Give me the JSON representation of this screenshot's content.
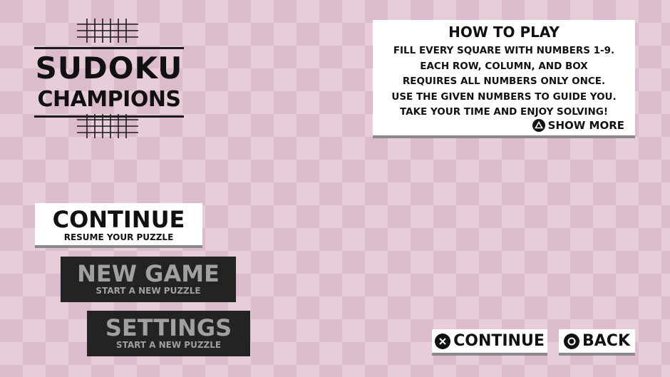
{
  "logo": {
    "line1": "SUDOKU",
    "line2": "CHAMPIONS"
  },
  "how_to_play": {
    "title": "HOW TO PLAY",
    "lines": [
      "FILL EVERY SQUARE WITH NUMBERS 1-9.",
      "EACH ROW, COLUMN, AND BOX",
      "REQUIRES ALL NUMBERS ONLY ONCE.",
      "USE THE GIVEN NUMBERS TO GUIDE YOU.",
      "TAKE YOUR TIME AND ENJOY SOLVING!"
    ],
    "show_more_label": "SHOW MORE",
    "show_more_icon": "triangle-button-icon"
  },
  "menu": {
    "continue": {
      "label": "CONTINUE",
      "sub": "RESUME YOUR PUZZLE"
    },
    "new_game": {
      "label": "NEW GAME",
      "sub": "START A NEW PUZZLE"
    },
    "settings": {
      "label": "SETTINGS",
      "sub": "START A NEW PUZZLE"
    }
  },
  "prompts": {
    "continue": {
      "label": "CONTINUE",
      "icon": "cross-button-icon"
    },
    "back": {
      "label": "BACK",
      "icon": "circle-button-icon"
    }
  },
  "colors": {
    "background": "#dcbccc",
    "background_tile": "#e6cdd9",
    "selected_button": "#ffffff",
    "unselected_button": "#232323",
    "unselected_text": "#a0a0a0"
  }
}
